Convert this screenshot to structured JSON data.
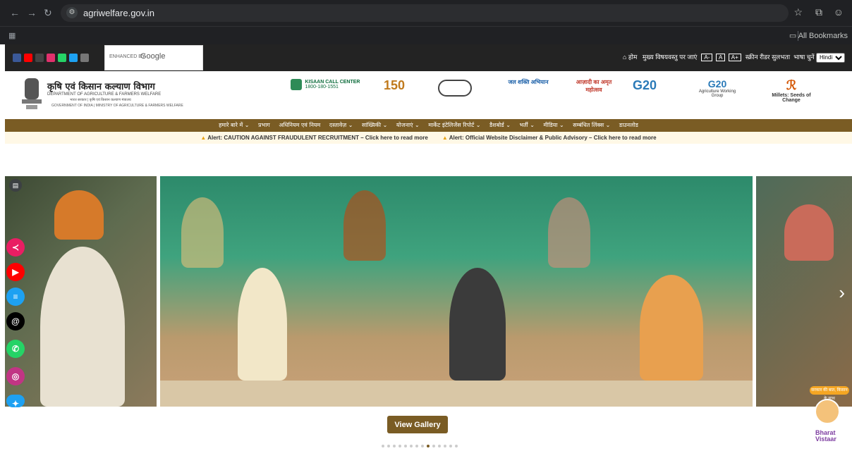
{
  "browser": {
    "url": "agriwelfare.gov.in",
    "bookmarks_label": "All Bookmarks"
  },
  "topbar": {
    "search_label": "ENHANCED BY",
    "search_brand": "Google",
    "home": "होम",
    "skip": "मुख्य विषयवस्तु पर जाएं",
    "font_small": "A-",
    "font_normal": "A",
    "font_large": "A+",
    "screen_reader": "स्क्रीन रीडर सुलभता",
    "language_label": "भाषा चुनें",
    "language_value": "Hindi"
  },
  "header": {
    "dept_hindi": "कृषि एवं किसान कल्याण विभाग",
    "dept_english": "DEPARTMENT OF AGRICULTURE & FARMERS WELFARE",
    "sub1_hindi": "भारत सरकार | कृषि एवं किसान कल्याण मंत्रालय",
    "sub2": "GOVERNMENT OF INDIA | MINISTRY OF AGRICULTURE & FARMERS WELFARE",
    "kcc_title": "KISAAN CALL CENTER",
    "kcc_number": "1800-180-1551",
    "logo_150": "150",
    "logo_jal": "जल शक्ति अभियान",
    "logo_azadi": "आज़ादी का अमृत महोत्सव",
    "logo_g20a": "G20",
    "logo_g20b": "G20",
    "g20b_sub": "Agriculture Working Group",
    "millets": "Millets: Seeds of Change"
  },
  "nav": {
    "items": [
      "हमारे बारे में ⌄",
      "प्रभाग",
      "अधिनियम एवं नियम",
      "दस्तावेज़ ⌄",
      "सांख्यिकी ⌄",
      "योजनाएं ⌄",
      "मार्केट इंटेलिजेंस रिपोर्ट ⌄",
      "डैशबोर्ड ⌄",
      "भर्ती ⌄",
      "मीडिया ⌄",
      "सम्बंधित लिंक्स ⌄",
      "डाउनलोड"
    ]
  },
  "alerts": {
    "a1": "Alert: CAUTION AGAINST FRAUDULENT RECRUITMENT – Click here to read more",
    "a2": "Alert: Official Website Disclaimer & Public Advisory – Click here to read more"
  },
  "hero": {
    "gallery_button": "View Gallery",
    "sticker": "सरकार की बात, किसान के साथ"
  },
  "bharat": {
    "line1": "Bharat",
    "line2": "Vistaar"
  },
  "colors": {
    "brand_brown": "#7a5c24",
    "topbar": "#232323",
    "alert_bg": "#fff8e6"
  }
}
